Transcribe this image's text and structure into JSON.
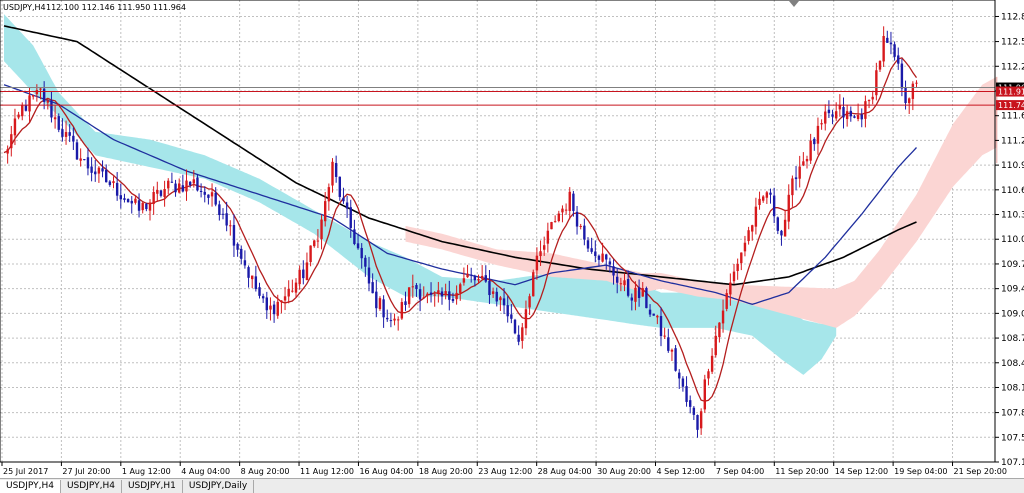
{
  "header": {
    "symbol": "USDJPY,H4",
    "quote": "112.100 112.146 111.950 111.964"
  },
  "tabs": [
    {
      "label": "USDJPY,H4",
      "active": true
    },
    {
      "label": "USDJPY,H4",
      "active": false
    },
    {
      "label": "USDJPY,H1",
      "active": false
    },
    {
      "label": "USDJPY,Daily",
      "active": false
    }
  ],
  "chart_data": {
    "type": "candlestick",
    "symbol": "USDJPY",
    "timeframe": "H4",
    "ylim": [
      107.19,
      113.08
    ],
    "grid": true,
    "y_ticks": [
      "112.870",
      "112.550",
      "112.235",
      "111.920",
      "111.605",
      "111.290",
      "110.975",
      "110.660",
      "110.345",
      "110.030",
      "109.715",
      "109.400",
      "109.085",
      "108.770",
      "108.455",
      "108.140",
      "107.820",
      "107.505",
      "107.190"
    ],
    "x_ticks": [
      "25 Jul 2017",
      "27 Jul 20:00",
      "1 Aug 12:00",
      "4 Aug 04:00",
      "8 Aug 20:00",
      "11 Aug 12:00",
      "16 Aug 04:00",
      "18 Aug 20:00",
      "23 Aug 12:00",
      "28 Aug 04:00",
      "30 Aug 20:00",
      "4 Sep 12:00",
      "7 Sep 04:00",
      "11 Sep 20:00",
      "14 Sep 12:00",
      "19 Sep 04:00",
      "21 Sep 20:00"
    ],
    "price_labels": [
      {
        "text": "111.964",
        "color": "#000000",
        "value": 111.964
      },
      {
        "text": "111.913",
        "color": "#c8141e",
        "value": 111.913
      },
      {
        "text": "111.740",
        "color": "#c8141e",
        "value": 111.74
      }
    ],
    "colors": {
      "up": "#d7191c",
      "down": "#1a1aa8",
      "cloud_bull": "#a6e6ea",
      "cloud_bear": "#fbd5d3",
      "ma_fast": "#b41e1e",
      "ma_mid": "#1f2f9e",
      "ma_slow": "#000000",
      "grid": "#c0c0c0"
    },
    "anchors_close": [
      [
        0,
        111.1
      ],
      [
        5,
        111.7
      ],
      [
        10,
        111.9
      ],
      [
        16,
        111.4
      ],
      [
        22,
        111.0
      ],
      [
        30,
        110.7
      ],
      [
        37,
        110.4
      ],
      [
        45,
        110.7
      ],
      [
        52,
        110.75
      ],
      [
        60,
        110.4
      ],
      [
        67,
        109.6
      ],
      [
        72,
        109.1
      ],
      [
        77,
        109.3
      ],
      [
        82,
        109.6
      ],
      [
        87,
        110.25
      ],
      [
        90,
        110.95
      ],
      [
        93,
        110.45
      ],
      [
        97,
        109.9
      ],
      [
        101,
        109.3
      ],
      [
        107,
        108.95
      ],
      [
        112,
        109.45
      ],
      [
        117,
        109.25
      ],
      [
        122,
        109.3
      ],
      [
        127,
        109.55
      ],
      [
        132,
        109.45
      ],
      [
        137,
        109.2
      ],
      [
        141,
        108.75
      ],
      [
        145,
        109.6
      ],
      [
        151,
        110.3
      ],
      [
        155,
        110.55
      ],
      [
        159,
        110.05
      ],
      [
        163,
        109.85
      ],
      [
        167,
        109.6
      ],
      [
        171,
        109.35
      ],
      [
        175,
        109.3
      ],
      [
        179,
        108.95
      ],
      [
        183,
        108.55
      ],
      [
        187,
        107.95
      ],
      [
        190,
        107.65
      ],
      [
        193,
        108.45
      ],
      [
        197,
        109.15
      ],
      [
        201,
        109.75
      ],
      [
        205,
        110.25
      ],
      [
        209,
        110.65
      ],
      [
        213,
        110.1
      ],
      [
        217,
        110.9
      ],
      [
        221,
        111.2
      ],
      [
        225,
        111.55
      ],
      [
        229,
        111.65
      ],
      [
        233,
        111.55
      ],
      [
        237,
        111.75
      ],
      [
        241,
        112.55
      ],
      [
        244,
        112.35
      ],
      [
        247,
        111.85
      ],
      [
        250,
        111.96
      ]
    ],
    "anchors_slow": [
      [
        0,
        112.75
      ],
      [
        20,
        112.55
      ],
      [
        40,
        111.95
      ],
      [
        60,
        111.35
      ],
      [
        80,
        110.75
      ],
      [
        100,
        110.3
      ],
      [
        120,
        110.0
      ],
      [
        140,
        109.8
      ],
      [
        160,
        109.65
      ],
      [
        180,
        109.55
      ],
      [
        200,
        109.45
      ],
      [
        215,
        109.55
      ],
      [
        230,
        109.8
      ],
      [
        245,
        110.15
      ],
      [
        250,
        110.25
      ]
    ],
    "anchors_mid": [
      [
        0,
        112.0
      ],
      [
        15,
        111.75
      ],
      [
        30,
        111.3
      ],
      [
        50,
        110.9
      ],
      [
        70,
        110.6
      ],
      [
        90,
        110.3
      ],
      [
        105,
        109.85
      ],
      [
        120,
        109.65
      ],
      [
        140,
        109.45
      ],
      [
        150,
        109.6
      ],
      [
        165,
        109.7
      ],
      [
        180,
        109.5
      ],
      [
        195,
        109.35
      ],
      [
        205,
        109.2
      ],
      [
        215,
        109.35
      ],
      [
        225,
        109.8
      ],
      [
        235,
        110.35
      ],
      [
        245,
        110.95
      ],
      [
        250,
        111.2
      ]
    ],
    "anchors_cloud_bull": [
      [
        0,
        112.9,
        112.3
      ],
      [
        8,
        112.5,
        111.9
      ],
      [
        15,
        111.9,
        111.6
      ],
      [
        25,
        111.4,
        111.1
      ],
      [
        40,
        111.3,
        110.95
      ],
      [
        55,
        111.1,
        110.8
      ],
      [
        70,
        110.8,
        110.5
      ],
      [
        85,
        110.4,
        110.1
      ],
      [
        100,
        110.0,
        109.55
      ],
      [
        110,
        109.8,
        109.3
      ],
      [
        120,
        109.55,
        109.3
      ],
      [
        135,
        109.5,
        109.2
      ],
      [
        150,
        109.6,
        109.1
      ],
      [
        165,
        109.65,
        109.0
      ],
      [
        172,
        109.5,
        108.95
      ],
      [
        180,
        109.35,
        108.9
      ],
      [
        195,
        109.35,
        108.9
      ],
      [
        205,
        109.4,
        108.8
      ],
      [
        213,
        109.2,
        108.5
      ],
      [
        219,
        109.0,
        108.3
      ],
      [
        224,
        108.95,
        108.5
      ],
      [
        228,
        109.0,
        108.8
      ]
    ],
    "anchors_cloud_bear": [
      [
        110,
        110.2,
        110.0
      ],
      [
        120,
        110.1,
        109.9
      ],
      [
        135,
        109.9,
        109.7
      ],
      [
        150,
        109.85,
        109.55
      ],
      [
        165,
        109.7,
        109.5
      ],
      [
        175,
        109.6,
        109.35
      ],
      [
        180,
        109.6,
        109.4
      ],
      [
        190,
        109.5,
        109.3
      ],
      [
        200,
        109.45,
        109.25
      ],
      [
        228,
        109.4,
        108.9
      ],
      [
        233,
        109.5,
        109.05
      ],
      [
        240,
        109.9,
        109.4
      ],
      [
        250,
        110.6,
        110.0
      ],
      [
        260,
        111.5,
        110.7
      ],
      [
        268,
        112.0,
        111.1
      ],
      [
        272,
        112.1,
        111.2
      ]
    ]
  }
}
